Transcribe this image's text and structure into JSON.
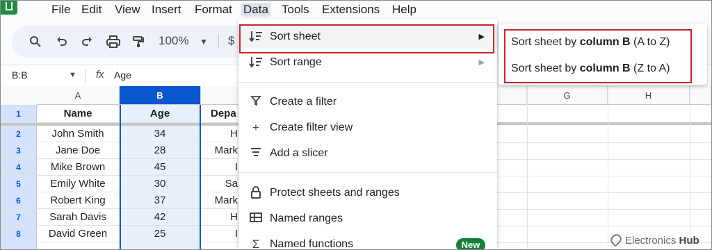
{
  "menubar": {
    "items": [
      "File",
      "Edit",
      "View",
      "Insert",
      "Format",
      "Data",
      "Tools",
      "Extensions",
      "Help"
    ],
    "active": "Data"
  },
  "toolbar": {
    "icons": [
      "search-icon",
      "undo-icon",
      "redo-icon",
      "print-icon",
      "paint-format-icon"
    ],
    "zoom": "100%",
    "currency": "$"
  },
  "formula_bar": {
    "name_box": "B:B",
    "fx": "fx",
    "value": "Age"
  },
  "grid": {
    "columns": [
      "A",
      "B",
      "G",
      "H"
    ],
    "selected_column": "B",
    "rows": [
      "1",
      "2",
      "3",
      "4",
      "5",
      "6",
      "7",
      "8"
    ],
    "header": {
      "name": "Name",
      "age": "Age",
      "dept": "Depa"
    },
    "data": [
      {
        "name": "John Smith",
        "age": "34",
        "dept": "H"
      },
      {
        "name": "Jane Doe",
        "age": "28",
        "dept": "Mark"
      },
      {
        "name": "Mike Brown",
        "age": "45",
        "dept": "I"
      },
      {
        "name": "Emily White",
        "age": "30",
        "dept": "Sa"
      },
      {
        "name": "Robert King",
        "age": "37",
        "dept": "Mark"
      },
      {
        "name": "Sarah Davis",
        "age": "42",
        "dept": "H"
      },
      {
        "name": "David Green",
        "age": "25",
        "dept": "I"
      }
    ]
  },
  "data_menu": {
    "items": {
      "sort_sheet": "Sort sheet",
      "sort_range": "Sort range",
      "create_filter": "Create a filter",
      "create_filter_view": "Create filter view",
      "add_slicer": "Add a slicer",
      "protect": "Protect sheets and ranges",
      "named_ranges": "Named ranges",
      "named_functions": "Named functions"
    },
    "new_badge": "New"
  },
  "sort_submenu": {
    "prefix": "Sort sheet by ",
    "column": "column B",
    "az": " (A to Z)",
    "za": " (Z to A)"
  },
  "watermark": {
    "brand1": "Electronics",
    "brand2": "Hub"
  }
}
